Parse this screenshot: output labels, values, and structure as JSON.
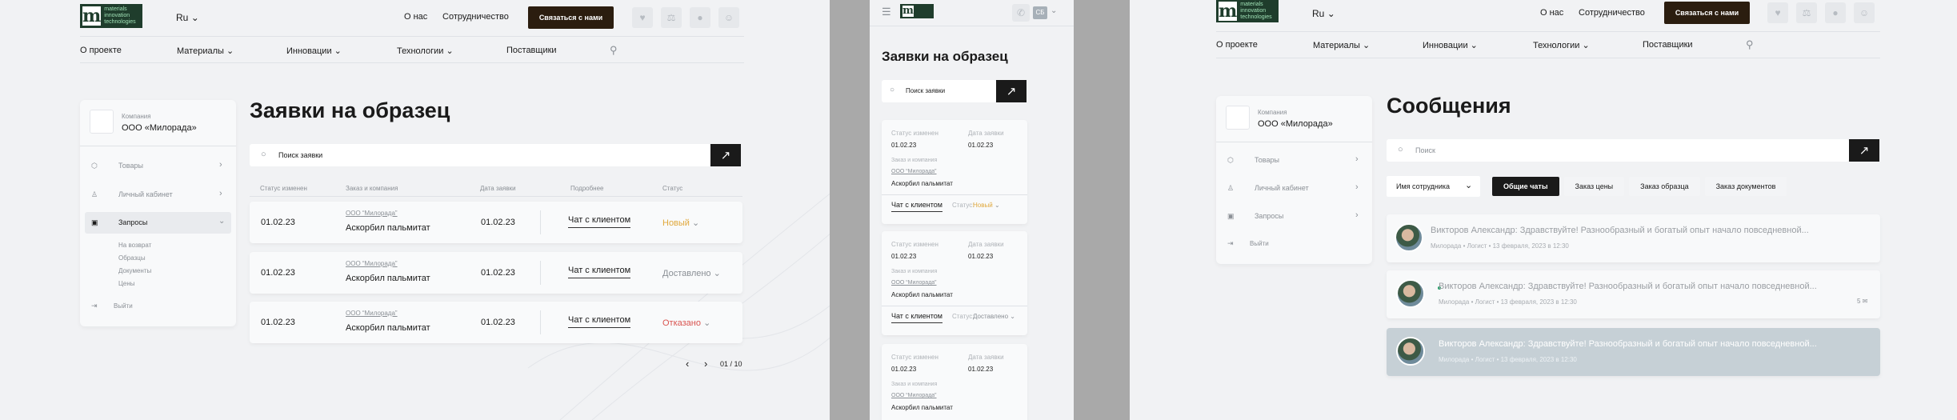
{
  "header": {
    "logo_text": "materials innovation technologies",
    "lang": "Ru",
    "about": "О нас",
    "cooperation": "Сотрудничество",
    "contact": "Связаться с нами"
  },
  "nav": {
    "items": [
      "О проекте",
      "Материалы",
      "Инновации",
      "Технологии",
      "Поставщики"
    ]
  },
  "sidebar": {
    "company_label": "Компания",
    "company_name": "ООО «Милорада»",
    "items": [
      "Товары",
      "Личный кабинет",
      "Запросы"
    ],
    "subitems": [
      "На возврат",
      "Образцы",
      "Документы",
      "Цены"
    ],
    "logout": "Выйти"
  },
  "requests": {
    "title": "Заявки на образец",
    "search_placeholder": "Поиск заявки",
    "columns": [
      "Статус изменен",
      "Заказ и компания",
      "Дата заявки",
      "Подробнее",
      "Статус"
    ],
    "rows": [
      {
        "changed": "01.02.23",
        "company": "ООО “Милорада”",
        "product": "Аскорбил пальмитат",
        "date": "01.02.23",
        "chat": "Чат с клиентом",
        "status": "Новый",
        "status_color": "#e0a83c"
      },
      {
        "changed": "01.02.23",
        "company": "ООО “Милорада”",
        "product": "Аскорбил пальмитат",
        "date": "01.02.23",
        "chat": "Чат с клиентом",
        "status": "Доставлено",
        "status_color": "#8a8f95"
      },
      {
        "changed": "01.02.23",
        "company": "ООО “Милорада”",
        "product": "Аскорбил пальмитат",
        "date": "01.02.23",
        "chat": "Чат с клиентом",
        "status": "Отказано",
        "status_color": "#d9534f"
      }
    ],
    "pagination": "01 / 10"
  },
  "mobile": {
    "user_initials": "СБ",
    "title": "Заявки на образец",
    "search_placeholder": "Поиск заявки",
    "changed_label": "Статус изменен",
    "date_label": "Дата заявки",
    "order_label": "Заказ и компания",
    "status_label": "Статус:",
    "cards": [
      {
        "changed": "01.02.23",
        "date": "01.02.23",
        "company": "ООО “Милорада”",
        "product": "Аскорбил пальмитат",
        "chat": "Чат с клиентом",
        "status": "Новый",
        "status_color": "#e0a83c"
      },
      {
        "changed": "01.02.23",
        "date": "01.02.23",
        "company": "ООО “Милорада”",
        "product": "Аскорбил пальмитат",
        "chat": "Чат с клиентом",
        "status": "Доставлено",
        "status_color": "#8a8f95"
      },
      {
        "changed": "01.02.23",
        "date": "01.02.23",
        "company": "ООО “Милорада”",
        "product": "Аскорбил пальмитат"
      }
    ]
  },
  "messages": {
    "title": "Сообщения",
    "search_placeholder": "Поиск",
    "employee_select": "Имя сотрудника",
    "tabs": [
      "Общие чаты",
      "Заказ цены",
      "Заказ образца",
      "Заказ документов"
    ],
    "items": [
      {
        "text": "Викторов Александр: Здравствуйте! Разнообразный и богатый опыт начало повседневной...",
        "meta": "Милорада  •  Логист  •  13 февраля, 2023 в 12:30",
        "badge": ""
      },
      {
        "text": "Викторов Александр: Здравствуйте! Разнообразный и богатый опыт начало повседневной...",
        "meta": "Милорада  •  Логист  •  13 февраля, 2023 в 12:30",
        "badge": "5 ✉"
      },
      {
        "text": "Викторов Александр: Здравствуйте! Разнообразный и богатый опыт начало повседневной...",
        "meta": "Милорада  •  Логист  •  13 февраля, 2023 в 12:30",
        "badge": ""
      }
    ]
  }
}
